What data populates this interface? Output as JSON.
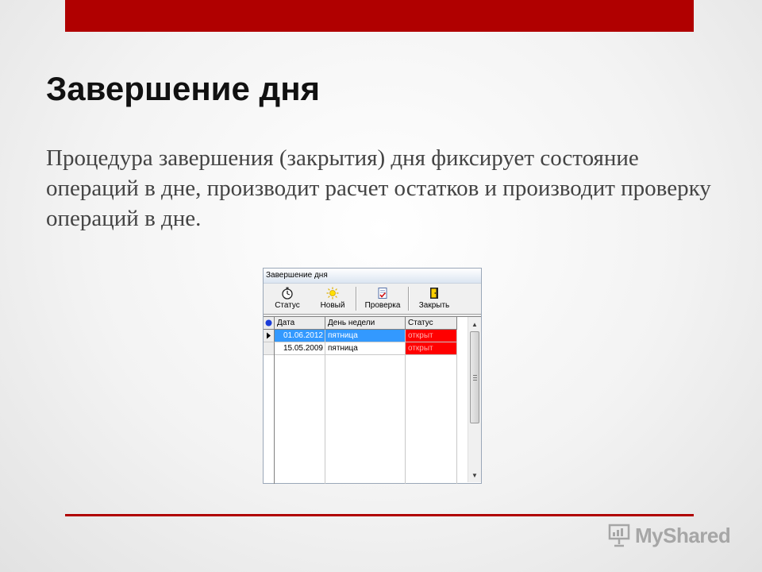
{
  "slide": {
    "title": "Завершение дня",
    "body": "Процедура завершения (закрытия) дня фиксирует состояние операций в дне, производит расчет остатков и производит проверку операций в дне."
  },
  "window": {
    "title": "Завершение дня",
    "toolbar": {
      "status_label": "Статус",
      "new_label": "Новый",
      "check_label": "Проверка",
      "close_label": "Закрыть"
    },
    "grid": {
      "columns": [
        "Дата",
        "День недели",
        "Статус"
      ],
      "rows": [
        {
          "date": "01.06.2012",
          "day": "пятница",
          "status": "открыт",
          "selected": true
        },
        {
          "date": "15.05.2009",
          "day": "пятница",
          "status": "открыт",
          "selected": false
        }
      ]
    }
  },
  "watermark": {
    "text": "MyShared"
  },
  "colors": {
    "accent": "#b00000",
    "selection": "#3399ff",
    "status_open": "#ff0000"
  }
}
